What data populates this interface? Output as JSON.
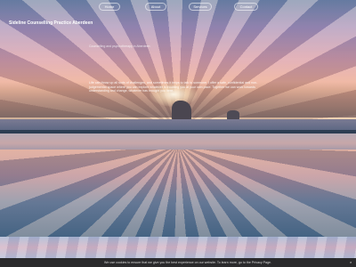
{
  "nav": {
    "items": [
      "Home",
      "About",
      "Services",
      "Contact"
    ]
  },
  "brand": {
    "name": "Sideline Counselling Practice Aberdeen"
  },
  "hero": {
    "tagline": "Counselling and psychotherapy in Aberdeen",
    "intro": "Life can throw up all sorts of challenges, and sometimes it helps to talk to someone. I offer a safe, confidential and non-judgemental space where you can explore whatever is troubling you at your own pace. Together we can work towards understanding and change, whatever has brought you here."
  },
  "cookie": {
    "message": "We use cookies to ensure that we give you the best experience on our website. To learn more, go to the Privacy Page.",
    "close": "×"
  }
}
